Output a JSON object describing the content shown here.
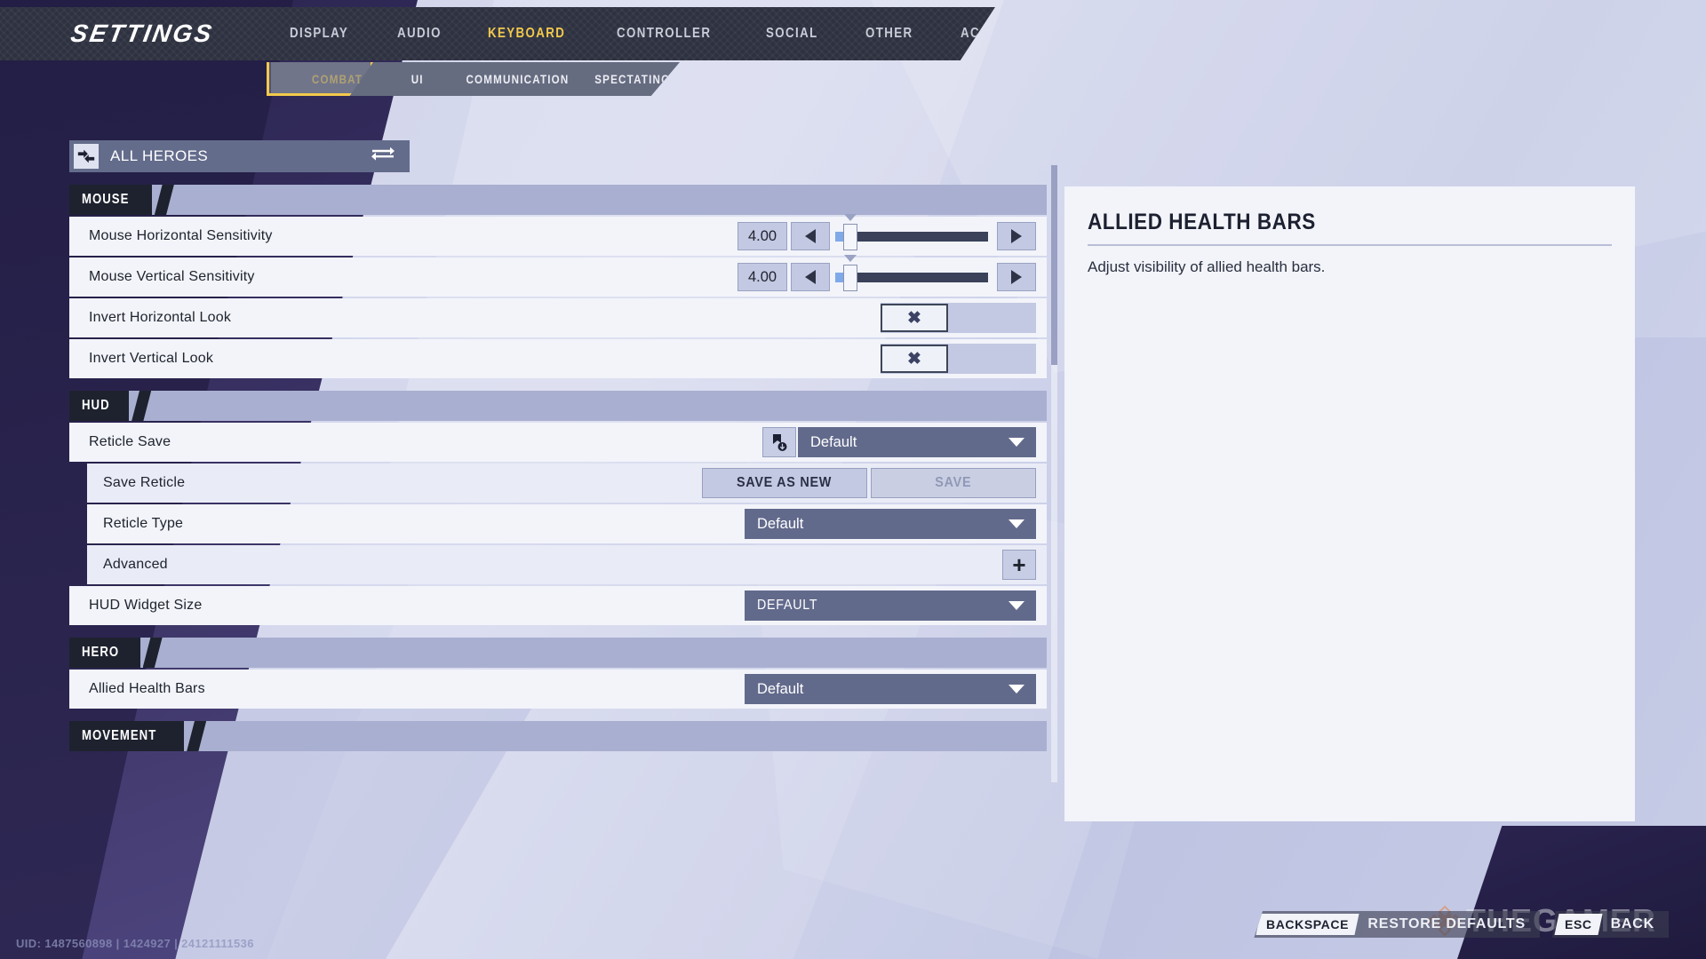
{
  "header": {
    "logo": "SETTINGS",
    "tabs": [
      {
        "label": "DISPLAY",
        "active": false
      },
      {
        "label": "AUDIO",
        "active": false
      },
      {
        "label": "KEYBOARD",
        "active": true
      },
      {
        "label": "CONTROLLER",
        "active": false
      },
      {
        "label": "SOCIAL",
        "active": false
      },
      {
        "label": "OTHER",
        "active": false
      },
      {
        "label": "ACCESSIBILITY",
        "active": false
      }
    ],
    "subtabs": [
      {
        "label": "COMBAT",
        "active": true
      },
      {
        "label": "UI",
        "active": false
      },
      {
        "label": "COMMUNICATION",
        "active": false
      },
      {
        "label": "SPECTATING",
        "active": false
      }
    ],
    "accent_color": "#f2c94c"
  },
  "hero_selector": {
    "label": "ALL HEROES",
    "icon": "all-heroes-icon",
    "swap_icon": "swap-arrows-icon"
  },
  "sections": [
    {
      "title": "MOUSE",
      "rows": [
        {
          "label": "Mouse Horizontal Sensitivity",
          "type": "slider",
          "value": "4.00",
          "fill_percent": 9
        },
        {
          "label": "Mouse Vertical Sensitivity",
          "type": "slider",
          "value": "4.00",
          "fill_percent": 9
        },
        {
          "label": "Invert Horizontal Look",
          "type": "checkbox",
          "checked": true,
          "mark": "✖"
        },
        {
          "label": "Invert Vertical Look",
          "type": "checkbox",
          "checked": true,
          "mark": "✖"
        }
      ]
    },
    {
      "title": "HUD",
      "rows": [
        {
          "label": "Reticle Save",
          "type": "dropdown_with_icon",
          "value": "Default",
          "icon": "reticle-save-icon"
        },
        {
          "label": "Save Reticle",
          "type": "buttons",
          "buttons": [
            {
              "label": "SAVE AS NEW",
              "disabled": false
            },
            {
              "label": "SAVE",
              "disabled": true
            }
          ],
          "indent": true
        },
        {
          "label": "Reticle Type",
          "type": "dropdown",
          "value": "Default",
          "indent": true
        },
        {
          "label": "Advanced",
          "type": "expand",
          "icon": "plus-icon",
          "indent": true
        },
        {
          "label": "HUD Widget Size",
          "type": "dropdown",
          "value": "DEFAULT"
        }
      ]
    },
    {
      "title": "HERO",
      "rows": [
        {
          "label": "Allied Health Bars",
          "type": "dropdown",
          "value": "Default"
        }
      ]
    },
    {
      "title": "MOVEMENT",
      "rows": []
    }
  ],
  "description": {
    "title": "ALLIED HEALTH BARS",
    "text": "Adjust visibility of allied health bars."
  },
  "footer": {
    "hints": [
      {
        "key": "BACKSPACE",
        "label": "RESTORE DEFAULTS"
      },
      {
        "key": "ESC",
        "label": "BACK"
      }
    ]
  },
  "uid": "UID: 1487560898 | 1424927 | 24121111536",
  "watermark": "THEGAMER"
}
